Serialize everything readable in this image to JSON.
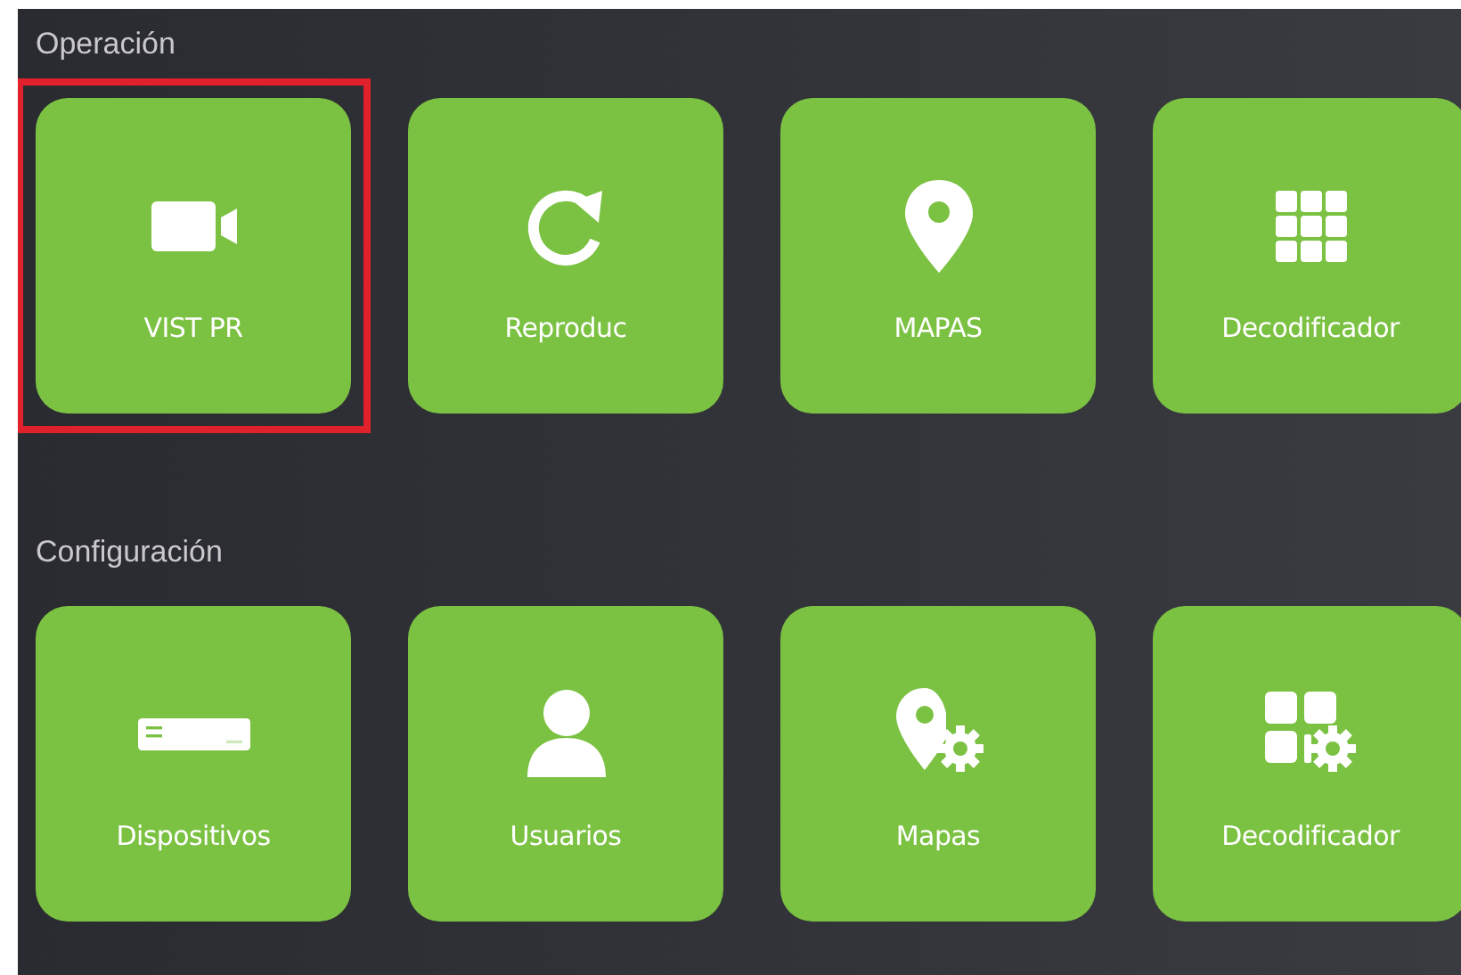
{
  "sections": [
    {
      "title": "Operación",
      "tiles": [
        {
          "label": "VIST PR",
          "kind": "camera",
          "selected": true
        },
        {
          "label": "Reproduc",
          "kind": "replay",
          "selected": false
        },
        {
          "label": "MAPAS",
          "kind": "pin",
          "selected": false
        },
        {
          "label": "Decodificador",
          "kind": "grid",
          "selected": false
        }
      ]
    },
    {
      "title": "Configuración",
      "tiles": [
        {
          "label": "Dispositivos",
          "kind": "device",
          "selected": false
        },
        {
          "label": "Usuarios",
          "kind": "user",
          "selected": false
        },
        {
          "label": "Mapas",
          "kind": "pin-gear",
          "selected": false
        },
        {
          "label": "Decodificador",
          "kind": "grid-gear",
          "selected": false
        }
      ]
    }
  ]
}
